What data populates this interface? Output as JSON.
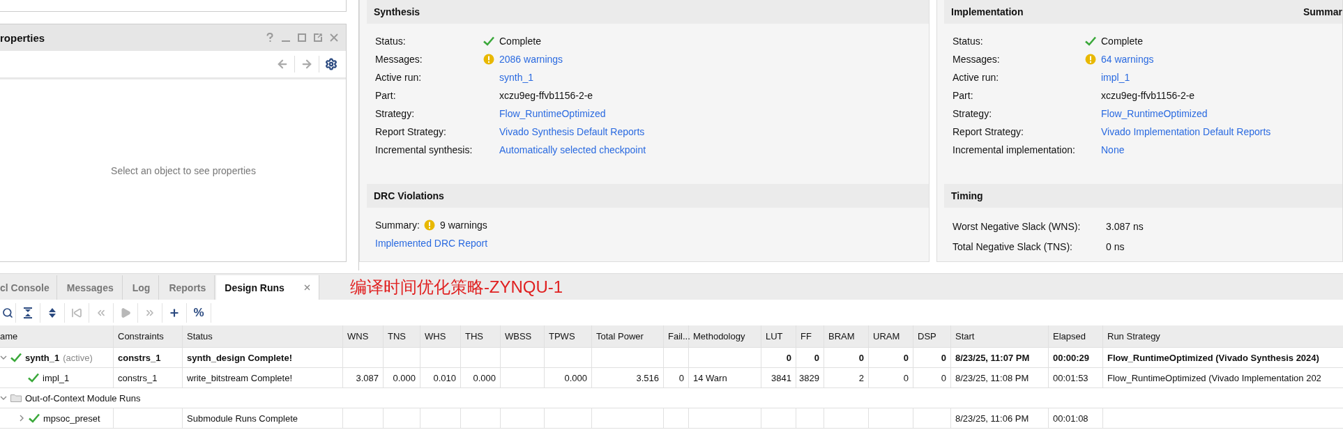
{
  "properties_panel": {
    "title": "roperties",
    "empty_text": "Select an object to see properties"
  },
  "synthesis": {
    "title": "Synthesis",
    "rows": [
      {
        "kind": "check",
        "label": "Status:",
        "value": "Complete",
        "link": false
      },
      {
        "kind": "warning",
        "label": "Messages:",
        "value": "2086 warnings",
        "link": true
      },
      {
        "kind": "plain",
        "label": "Active run:",
        "value": "synth_1",
        "link": true
      },
      {
        "kind": "plain",
        "label": "Part:",
        "value": "xczu9eg-ffvb1156-2-e",
        "link": false
      },
      {
        "kind": "plain",
        "label": "Strategy:",
        "value": "Flow_RuntimeOptimized",
        "link": true
      },
      {
        "kind": "plain",
        "label": "Report Strategy:",
        "value": "Vivado Synthesis Default Reports",
        "link": true
      },
      {
        "kind": "plain",
        "label": "Incremental synthesis:",
        "value": "Automatically selected checkpoint",
        "link": true
      }
    ]
  },
  "drc": {
    "title": "DRC Violations",
    "summary_label": "Summary:",
    "summary": "9 warnings",
    "warning": true,
    "report_link": "Implemented DRC Report"
  },
  "implementation": {
    "title": "Implementation",
    "side_title": "Summar",
    "rows": [
      {
        "kind": "check",
        "label": "Status:",
        "value": "Complete",
        "link": false
      },
      {
        "kind": "warning",
        "label": "Messages:",
        "value": "64 warnings",
        "link": true
      },
      {
        "kind": "plain",
        "label": "Active run:",
        "value": "impl_1",
        "link": true
      },
      {
        "kind": "plain",
        "label": "Part:",
        "value": "xczu9eg-ffvb1156-2-e",
        "link": false
      },
      {
        "kind": "plain",
        "label": "Strategy:",
        "value": "Flow_RuntimeOptimized",
        "link": true
      },
      {
        "kind": "plain",
        "label": "Report Strategy:",
        "value": "Vivado Implementation Default Reports",
        "link": true
      },
      {
        "kind": "plain",
        "label": "Incremental implementation:",
        "value": "None",
        "link": true
      }
    ]
  },
  "timing": {
    "title": "Timing",
    "rows": [
      {
        "label": "Worst Negative Slack (WNS):",
        "value": "3.087 ns"
      },
      {
        "label": "Total Negative Slack (TNS):",
        "value": "0 ns"
      }
    ]
  },
  "bottom_tabs": [
    {
      "label": "cl Console",
      "selected": false
    },
    {
      "label": "Messages",
      "selected": false
    },
    {
      "label": "Log",
      "selected": false
    },
    {
      "label": "Reports",
      "selected": false
    },
    {
      "label": "Design Runs",
      "selected": true,
      "closable": true
    }
  ],
  "annotation": "编译时间优化策略-ZYNQU-1",
  "toolbar": [
    {
      "kind": "search",
      "disabled": false
    },
    {
      "kind": "collapse",
      "disabled": false
    },
    {
      "kind": "expand",
      "disabled": false
    },
    {
      "kind": "first",
      "disabled": true
    },
    {
      "kind": "previous",
      "disabled": true
    },
    {
      "kind": "run",
      "disabled": true
    },
    {
      "kind": "next",
      "disabled": true
    },
    {
      "kind": "add",
      "disabled": false
    },
    {
      "kind": "percent",
      "label": "%",
      "disabled": false
    }
  ],
  "table": {
    "columns": [
      "ame",
      "Constraints",
      "Status",
      "WNS",
      "TNS",
      "WHS",
      "THS",
      "WBSS",
      "TPWS",
      "Total Power",
      "Fail...",
      "Methodology",
      "LUT",
      "FF",
      "BRAM",
      "URAM",
      "DSP",
      "Start",
      "Elapsed",
      "Run Strategy"
    ],
    "rows": [
      {
        "kind": "run",
        "name": "synth_1",
        "note": "(active)",
        "active": true,
        "expanded": true,
        "cells": [
          "constrs_1",
          "synth_design Complete!",
          null,
          null,
          null,
          null,
          null,
          null,
          null,
          null,
          null,
          "0",
          "0",
          "0",
          "0",
          "0",
          "8/23/25, 11:07 PM",
          "00:00:29",
          "Flow_RuntimeOptimized (Vivado Synthesis 2024)"
        ],
        "children": [
          {
            "kind": "run",
            "name": "impl_1",
            "active": false,
            "cells": [
              "constrs_1",
              "write_bitstream Complete!",
              "3.087",
              "0.000",
              "0.010",
              "0.000",
              null,
              "0.000",
              "3.516",
              "0",
              "14 Warn",
              "3841",
              "3829",
              "2",
              "0",
              "0",
              "8/23/25, 11:08 PM",
              "00:01:53",
              "Flow_RuntimeOptimized (Vivado Implementation 202"
            ]
          }
        ]
      },
      {
        "kind": "group",
        "name": "Out-of-Context Module Runs",
        "expanded": true,
        "children": [
          {
            "kind": "run",
            "name": "mpsoc_preset",
            "active": false,
            "expanded": false,
            "cells": [
              null,
              "Submodule Runs Complete",
              null,
              null,
              null,
              null,
              null,
              null,
              null,
              null,
              null,
              null,
              null,
              null,
              null,
              null,
              "8/23/25, 11:06 PM",
              "00:01:08",
              null
            ]
          }
        ]
      }
    ]
  }
}
